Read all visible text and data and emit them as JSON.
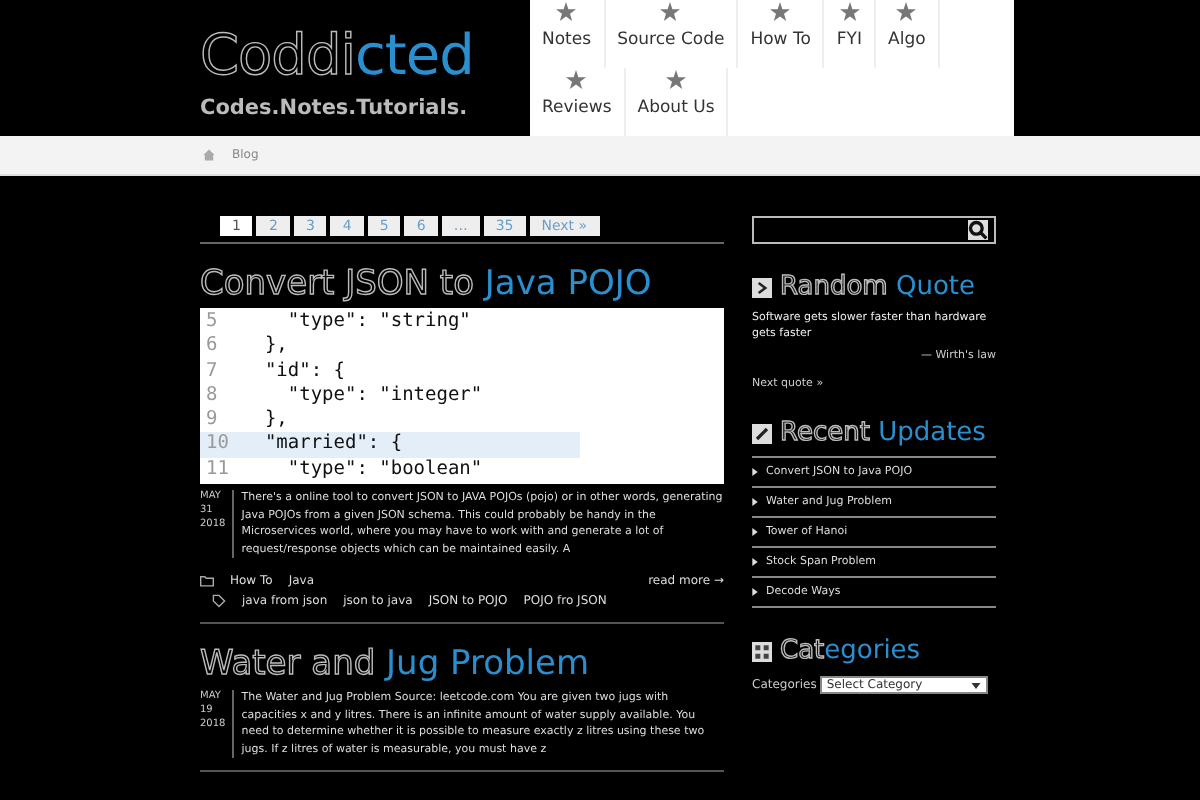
{
  "logo": {
    "dim": "Coddi",
    "bright": "cted",
    "tagline": "Codes.Notes.Tutorials."
  },
  "nav": {
    "rows": [
      [
        "Notes",
        "Source Code",
        "How To",
        "FYI",
        "Algo"
      ],
      [
        "Reviews",
        "About Us"
      ]
    ]
  },
  "breadcrumb": [
    "Blog"
  ],
  "pagination": [
    {
      "label": "1",
      "selected": true
    },
    {
      "label": "2",
      "selected": false
    },
    {
      "label": "3",
      "selected": false
    },
    {
      "label": "4",
      "selected": false
    },
    {
      "label": "5",
      "selected": false
    },
    {
      "label": "6",
      "selected": false
    },
    {
      "label": "…",
      "selected": false
    },
    {
      "label": "35",
      "selected": false
    },
    {
      "label": "Next »",
      "selected": false
    }
  ],
  "posts": [
    {
      "title_dim": "Convert JSON to",
      "title_bright": "Java POJO",
      "date": [
        "MAY",
        "31",
        "2018"
      ],
      "code": [
        {
          "n": "5",
          "text": "    \"type\": \"string\"",
          "highlighted": false
        },
        {
          "n": "6",
          "text": "  },",
          "highlighted": false
        },
        {
          "n": "7",
          "text": "  \"id\": {",
          "highlighted": false
        },
        {
          "n": "8",
          "text": "    \"type\": \"integer\"",
          "highlighted": false
        },
        {
          "n": "9",
          "text": "  },",
          "highlighted": false
        },
        {
          "n": "10",
          "text": "  \"married\": {",
          "highlighted": true
        },
        {
          "n": "11",
          "text": "    \"type\": \"boolean\"",
          "highlighted": false
        }
      ],
      "excerpt": "There's a online tool to convert JSON to JAVA POJOs (pojo) or in other words, generating Java POJOs from a given JSON schema. This could probably be handy in the Microservices world, where you may have to work with and generate a lot of request/response objects which can be maintained easily. A",
      "categories": [
        "How To",
        "Java"
      ],
      "tags": [
        "java from json",
        "json to java",
        "JSON to POJO",
        "POJO fro JSON"
      ],
      "more": "read more →"
    },
    {
      "title_dim": "Water and",
      "title_bright": "Jug Problem",
      "date": [
        "MAY",
        "19",
        "2018"
      ],
      "excerpt": "The Water and Jug Problem Source: leetcode.com You are given two jugs with capacities x and y litres. There is an infinite amount of water supply available. You need to determine whether it is possible to measure exactly z litres using these two jugs. If z litres of water is measurable, you must have z"
    }
  ],
  "sidebar": {
    "quote": {
      "dim": "Random",
      "bright": "Quote",
      "text": "Software gets slower faster than hardware gets faster",
      "author": "— Wirth's law",
      "next": "Next quote »"
    },
    "updates": {
      "dim": "Recent",
      "bright": "Updates",
      "items": [
        "Convert JSON to Java POJO",
        "Water and Jug Problem",
        "Tower of Hanoi",
        "Stock Span Problem",
        "Decode Ways"
      ]
    },
    "categories": {
      "dim": "Cat",
      "bright": "egories",
      "label": "Categories",
      "select": "Select Category"
    }
  }
}
